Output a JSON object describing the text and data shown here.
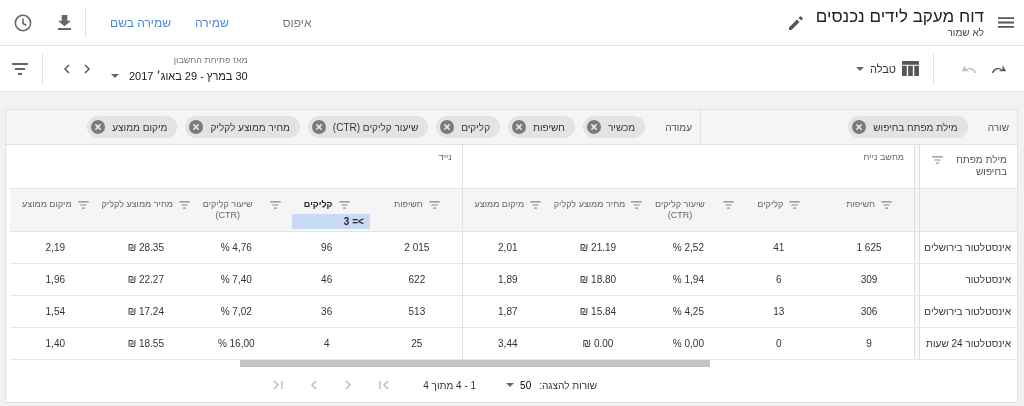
{
  "header": {
    "title": "דוח מעקב לידים נכנסים",
    "subtitle": "לא שמור",
    "actions": [
      {
        "label": "איפוס",
        "disabled": true
      },
      {
        "label": "שמירה",
        "disabled": false
      },
      {
        "label": "שמירה בשם",
        "disabled": false
      }
    ]
  },
  "toolbar": {
    "history": [
      {
        "kind": "redo",
        "disabled": false
      },
      {
        "kind": "undo",
        "disabled": true
      }
    ],
    "view": "טבלה",
    "date_caption": "מאז פתיחת החשבון",
    "date_range": "30 במרץ - 29 באוג׳ 2017"
  },
  "rows_section": {
    "label": "שורה",
    "chips": [
      "מילת מפתח בחיפוש"
    ]
  },
  "columns_section": {
    "label": "עמודה",
    "chips": [
      "מכשיר",
      "חשיפות",
      "קליקים",
      "שיעור קליקים (CTR)",
      "מחיר ממוצע לקליק",
      "מיקום ממוצע"
    ]
  },
  "table": {
    "first_column": "מילת מפתח בחיפוש",
    "groups": [
      {
        "name": "מחשב נייח",
        "columns": [
          {
            "label": "חשיפות"
          },
          {
            "label": "קליקים"
          },
          {
            "label": "שיעור קליקים (CTR)"
          },
          {
            "label": "מחיר ממוצע לקליק"
          },
          {
            "label": "מיקום ממוצע"
          }
        ]
      },
      {
        "name": "נייד",
        "columns": [
          {
            "label": "חשיפות"
          },
          {
            "label": "קליקים",
            "filter": ">= 3"
          },
          {
            "label": "שיעור קליקים (CTR)"
          },
          {
            "label": "מחיר ממוצע לקליק"
          },
          {
            "label": "מיקום ממוצע"
          }
        ]
      }
    ],
    "rows": [
      {
        "keyword": "אינסטלטור בירושלים",
        "cells": [
          "1 625",
          "41",
          "2,52 %",
          "21.19 ₪",
          "2,01",
          "2 015",
          "96",
          "4,76 %",
          "28.35 ₪",
          "2,19"
        ]
      },
      {
        "keyword": "אינסטלטור",
        "cells": [
          "309",
          "6",
          "1,94 %",
          "18.80 ₪",
          "1,89",
          "622",
          "46",
          "7,40 %",
          "22.27 ₪",
          "1,96"
        ]
      },
      {
        "keyword": "אינסטלטור בירושלים",
        "cells": [
          "306",
          "13",
          "4,25 %",
          "15.84 ₪",
          "1,87",
          "513",
          "36",
          "7,02 %",
          "17.24 ₪",
          "1,54"
        ]
      },
      {
        "keyword": "אינסטלטור 24 שעות",
        "cells": [
          "9",
          "0",
          "0,00 %",
          "0.00 ₪",
          "3,44",
          "25",
          "4",
          "16,00 %",
          "18.55 ₪",
          "1,40"
        ]
      }
    ]
  },
  "pagination": {
    "rows_label": "שורות להצגה:",
    "page_size": "50",
    "range": "1 - 4 מתוך 4"
  }
}
